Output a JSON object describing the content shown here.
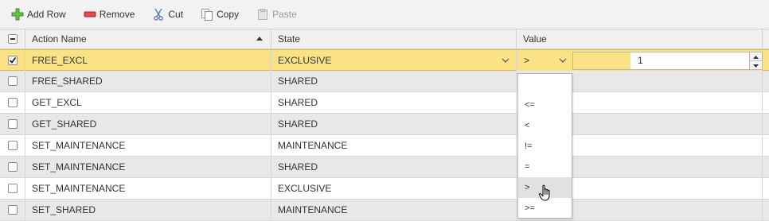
{
  "toolbar": {
    "add_row": "Add Row",
    "remove": "Remove",
    "cut": "Cut",
    "copy": "Copy",
    "paste": "Paste"
  },
  "header": {
    "action_name": "Action Name",
    "state": "State",
    "value": "Value",
    "sort": "ascending"
  },
  "rows": [
    {
      "action": "FREE_EXCL",
      "state": "EXCLUSIVE",
      "checked": true,
      "operator": ">",
      "value": "1"
    },
    {
      "action": "FREE_SHARED",
      "state": "SHARED",
      "checked": false
    },
    {
      "action": "GET_EXCL",
      "state": "SHARED",
      "checked": false
    },
    {
      "action": "GET_SHARED",
      "state": "SHARED",
      "checked": false
    },
    {
      "action": "SET_MAINTENANCE",
      "state": "MAINTENANCE",
      "checked": false
    },
    {
      "action": "SET_MAINTENANCE",
      "state": "SHARED",
      "checked": false
    },
    {
      "action": "SET_MAINTENANCE",
      "state": "EXCLUSIVE",
      "checked": false
    },
    {
      "action": "SET_SHARED",
      "state": "MAINTENANCE",
      "checked": false
    }
  ],
  "operator_dropdown": {
    "options": [
      "",
      "<=",
      "<",
      "!=",
      "=",
      ">",
      ">="
    ],
    "hovered": ">"
  },
  "colors": {
    "selected_row": "#fbe287",
    "odd_row": "#e8e8e8",
    "even_row": "#ffffff",
    "header": "#f0f0f0",
    "toolbar": "#f2f2f2",
    "add_icon": "#4caf50",
    "remove_icon": "#e53935"
  }
}
